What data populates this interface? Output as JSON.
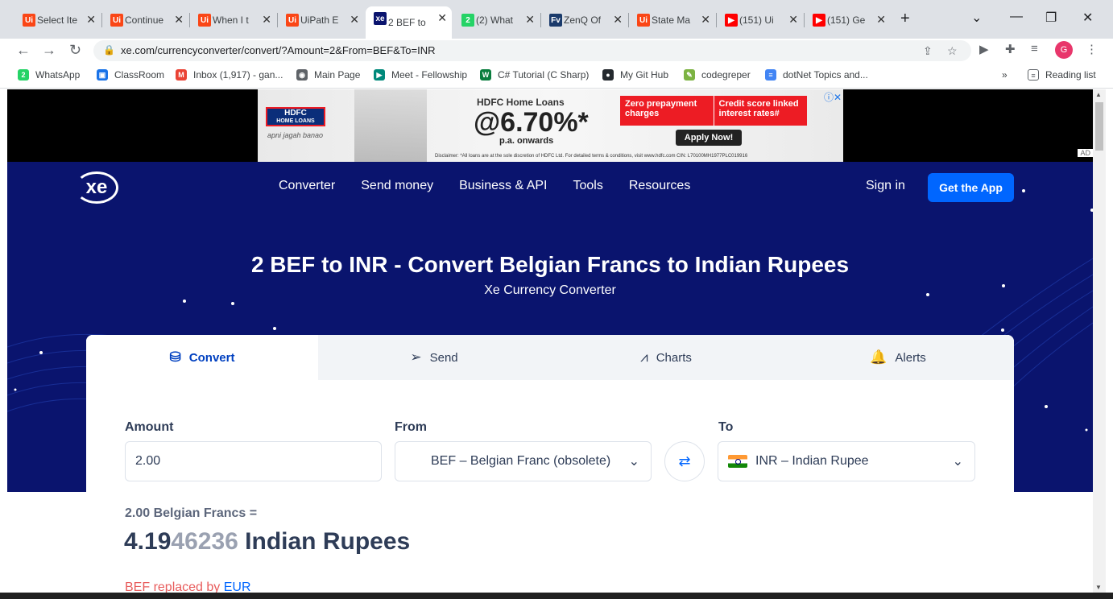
{
  "tabs": [
    {
      "title": "Select Ite",
      "icon": "uipath-icon",
      "color": "#fa4616",
      "glyph": "Ui"
    },
    {
      "title": "Continue",
      "icon": "uipath-icon",
      "color": "#fa4616",
      "glyph": "Ui"
    },
    {
      "title": "When I t",
      "icon": "uipath-icon",
      "color": "#fa4616",
      "glyph": "Ui"
    },
    {
      "title": "UiPath E",
      "icon": "uipath-icon",
      "color": "#fa4616",
      "glyph": "Ui"
    },
    {
      "title": "2 BEF to",
      "icon": "xe-icon",
      "color": "#0a146e",
      "glyph": "xe"
    },
    {
      "title": "(2) What",
      "icon": "whatsapp-icon",
      "color": "#25d366",
      "glyph": "2"
    },
    {
      "title": "ZenQ Of",
      "icon": "zenq-icon",
      "color": "#1a3a6b",
      "glyph": "Fv"
    },
    {
      "title": "State Ma",
      "icon": "uipath-icon",
      "color": "#fa4616",
      "glyph": "Ui"
    },
    {
      "title": "(151) Ui",
      "icon": "youtube-icon",
      "color": "#ff0000",
      "glyph": "▶"
    },
    {
      "title": "(151) Ge",
      "icon": "youtube-icon",
      "color": "#ff0000",
      "glyph": "▶"
    }
  ],
  "address": {
    "url": "xe.com/currencyconverter/convert/?Amount=2&From=BEF&To=INR"
  },
  "profile": {
    "initial": "G"
  },
  "bookmarks": [
    {
      "label": "WhatsApp",
      "color": "#25d366",
      "glyph": "2"
    },
    {
      "label": "ClassRoom",
      "color": "#1a73e8",
      "glyph": "▣"
    },
    {
      "label": "Inbox (1,917) - gan...",
      "color": "#ea4335",
      "glyph": "M"
    },
    {
      "label": "Main Page",
      "color": "#5f6368",
      "glyph": "◉"
    },
    {
      "label": "Meet - Fellowship",
      "color": "#00897b",
      "glyph": "▶"
    },
    {
      "label": "C# Tutorial (C Sharp)",
      "color": "#0a7d3e",
      "glyph": "W"
    },
    {
      "label": "My Git Hub",
      "color": "#24292e",
      "glyph": "●"
    },
    {
      "label": "codegreper",
      "color": "#7cb342",
      "glyph": "✎"
    },
    {
      "label": "dotNet Topics and...",
      "color": "#4285f4",
      "glyph": "≡"
    }
  ],
  "reading_list": "Reading list",
  "more_bookmarks": "»",
  "ad": {
    "logo_line1": "HDFC",
    "logo_line2": "HOME LOANS",
    "tagline": "apni jagah banao",
    "headline": "HDFC Home Loans",
    "rate": "@6.70%*",
    "rate_suffix": "p.a. onwards",
    "box_left": "Zero prepayment charges",
    "box_right": "Credit score linked interest rates#",
    "cta": "Apply Now!",
    "disclaimer": "Disclaimer: *All loans are at the sole discretion of HDFC Ltd. For detailed terms & conditions, visit www.hdfc.com  CIN: L70100MH1977PLC019916",
    "badge": "AD"
  },
  "site": {
    "logo": "xe",
    "nav": [
      "Converter",
      "Send money",
      "Business & API",
      "Tools",
      "Resources"
    ],
    "sign_in": "Sign in",
    "get_app": "Get the App",
    "title": "2 BEF to INR - Convert Belgian Francs to Indian Rupees",
    "subtitle": "Xe Currency Converter"
  },
  "converter": {
    "tabs": [
      {
        "label": "Convert",
        "icon": "coins-icon",
        "glyph": "⛁"
      },
      {
        "label": "Send",
        "icon": "send-icon",
        "glyph": "➢"
      },
      {
        "label": "Charts",
        "icon": "chart-icon",
        "glyph": "⩘"
      },
      {
        "label": "Alerts",
        "icon": "bell-icon",
        "glyph": "🔔"
      }
    ],
    "amount_label": "Amount",
    "amount_value": "2.00",
    "from_label": "From",
    "from_value": "BEF – Belgian Franc (obsolete)",
    "to_label": "To",
    "to_value": "INR – Indian Rupee",
    "result_from": "2.00 Belgian Francs =",
    "result_main": "4.19",
    "result_dim": "46236",
    "result_unit": " Indian Rupees",
    "replaced_text": "BEF replaced by ",
    "replaced_link": "EUR"
  }
}
